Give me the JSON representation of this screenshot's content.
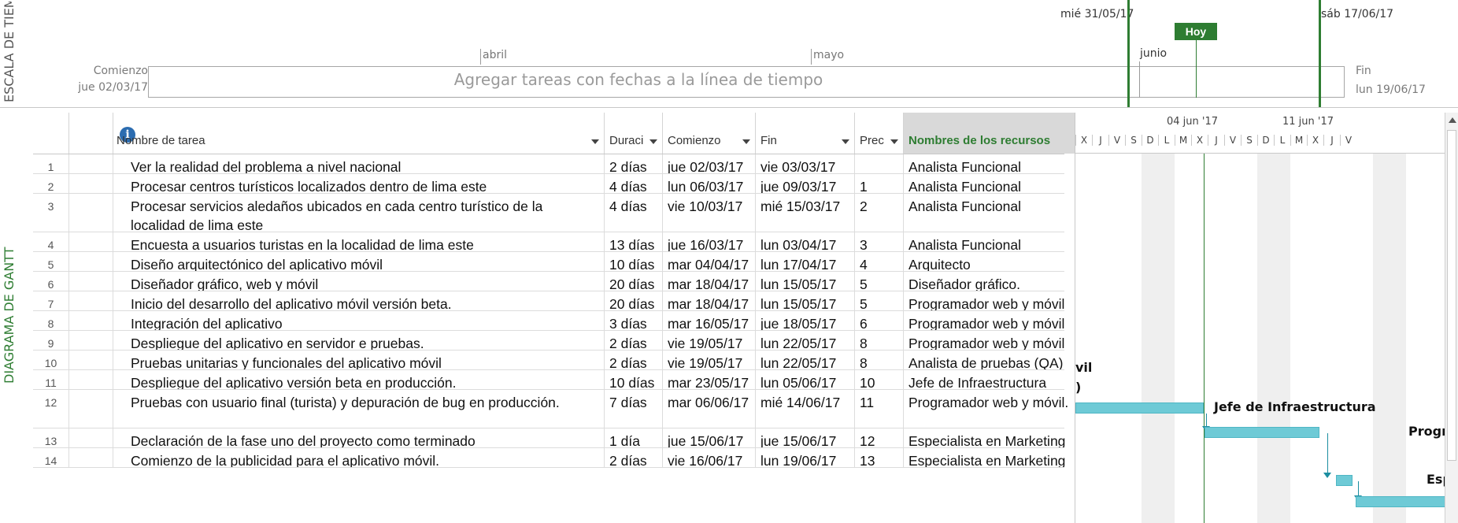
{
  "timeline": {
    "vertical_label": "ESCALA DE TIEM",
    "start_label": "Comienzo",
    "start_date": "jue 02/03/17",
    "end_label": "Fin",
    "end_date": "lun 19/06/17",
    "placeholder": "Agregar tareas con fechas a la línea de tiempo",
    "months": [
      "abril",
      "mayo",
      "junio"
    ],
    "left_marker": "mié 31/05/17",
    "right_marker": "sáb 17/06/17",
    "today": "Hoy",
    "accent_color": "#2e7d32"
  },
  "gantt": {
    "vertical_label": "DIAGRAMA DE GANTT",
    "columns": {
      "info": "i",
      "name": "Nombre de tarea",
      "duration": "Duraci",
      "start": "Comienzo",
      "finish": "Fin",
      "pred": "Prec",
      "resources": "Nombres de los recursos"
    },
    "rows": [
      {
        "id": "1",
        "name": "Ver la realidad del problema a nivel nacional",
        "duration": "2 días",
        "start": "jue 02/03/17",
        "finish": "vie 03/03/17",
        "pred": "",
        "resource": "Analista Funcional"
      },
      {
        "id": "2",
        "name": "Procesar centros turísticos localizados dentro de lima este",
        "duration": "4 días",
        "start": "lun 06/03/17",
        "finish": "jue 09/03/17",
        "pred": "1",
        "resource": "Analista Funcional"
      },
      {
        "id": "3",
        "name": "Procesar servicios aledaños ubicados en cada centro turístico de la localidad de lima este",
        "duration": "4 días",
        "start": "vie 10/03/17",
        "finish": "mié 15/03/17",
        "pred": "2",
        "resource": "Analista Funcional"
      },
      {
        "id": "4",
        "name": "Encuesta a usuarios turistas en la localidad de lima este",
        "duration": "13 días",
        "start": "jue 16/03/17",
        "finish": "lun 03/04/17",
        "pred": "3",
        "resource": "Analista Funcional"
      },
      {
        "id": "5",
        "name": "Diseño arquitectónico del aplicativo móvil",
        "duration": "10 días",
        "start": "mar 04/04/17",
        "finish": "lun 17/04/17",
        "pred": "4",
        "resource": "Arquitecto"
      },
      {
        "id": "6",
        "name": "Diseñador gráfico, web y móvil",
        "duration": "20 días",
        "start": "mar 18/04/17",
        "finish": "lun 15/05/17",
        "pred": "5",
        "resource": "Diseñador gráfico."
      },
      {
        "id": "7",
        "name": "Inicio del desarrollo del aplicativo móvil versión beta.",
        "duration": "20 días",
        "start": "mar 18/04/17",
        "finish": "lun 15/05/17",
        "pred": "5",
        "resource": "Programador web y móvil"
      },
      {
        "id": "8",
        "name": "Integración del aplicativo",
        "duration": "3 días",
        "start": "mar 16/05/17",
        "finish": "jue 18/05/17",
        "pred": "6",
        "resource": "Programador web y móvil"
      },
      {
        "id": "9",
        "name": "Despliegue del aplicativo en servidor e pruebas.",
        "duration": "2 días",
        "start": "vie 19/05/17",
        "finish": "lun 22/05/17",
        "pred": "8",
        "resource": "Programador web y móvil"
      },
      {
        "id": "10",
        "name": "Pruebas unitarias y funcionales del aplicativo móvil",
        "duration": "2 días",
        "start": "vie 19/05/17",
        "finish": "lun 22/05/17",
        "pred": "8",
        "resource": "Analista de pruebas (QA)"
      },
      {
        "id": "11",
        "name": "Despliegue del aplicativo versión beta en producción.",
        "duration": "10 días",
        "start": "mar 23/05/17",
        "finish": "lun 05/06/17",
        "pred": "10",
        "resource": "Jefe de Infraestructura"
      },
      {
        "id": "12",
        "name": "Pruebas con usuario final (turista) y depuración de bug en producción.",
        "duration": "7 días",
        "start": "mar 06/06/17",
        "finish": "mié 14/06/17",
        "pred": "11",
        "resource": "Programador web y móvil."
      },
      {
        "id": "13",
        "name": "Declaración de la fase uno del proyecto como terminado",
        "duration": "1 día",
        "start": "jue 15/06/17",
        "finish": "jue 15/06/17",
        "pred": "12",
        "resource": "Especialista en Marketing"
      },
      {
        "id": "14",
        "name": "Comienzo de la publicidad para el aplicativo móvil.",
        "duration": "2 días",
        "start": "vie 16/06/17",
        "finish": "lun 19/06/17",
        "pred": "13",
        "resource": "Especialista en Marketing"
      }
    ]
  },
  "chart": {
    "weeks": [
      "04 jun '17",
      "11 jun '17"
    ],
    "day_letters": [
      "X",
      "J",
      "V",
      "S",
      "D",
      "L",
      "M",
      "X",
      "J",
      "V",
      "S",
      "D",
      "L",
      "M",
      "X",
      "J",
      "V"
    ],
    "bar_labels": {
      "r9": "vil",
      "r10": ")",
      "r11": "Jefe de Infraestructura",
      "r12": "Progra",
      "r13": "Esp"
    },
    "bar_color": "#6ecad6"
  }
}
